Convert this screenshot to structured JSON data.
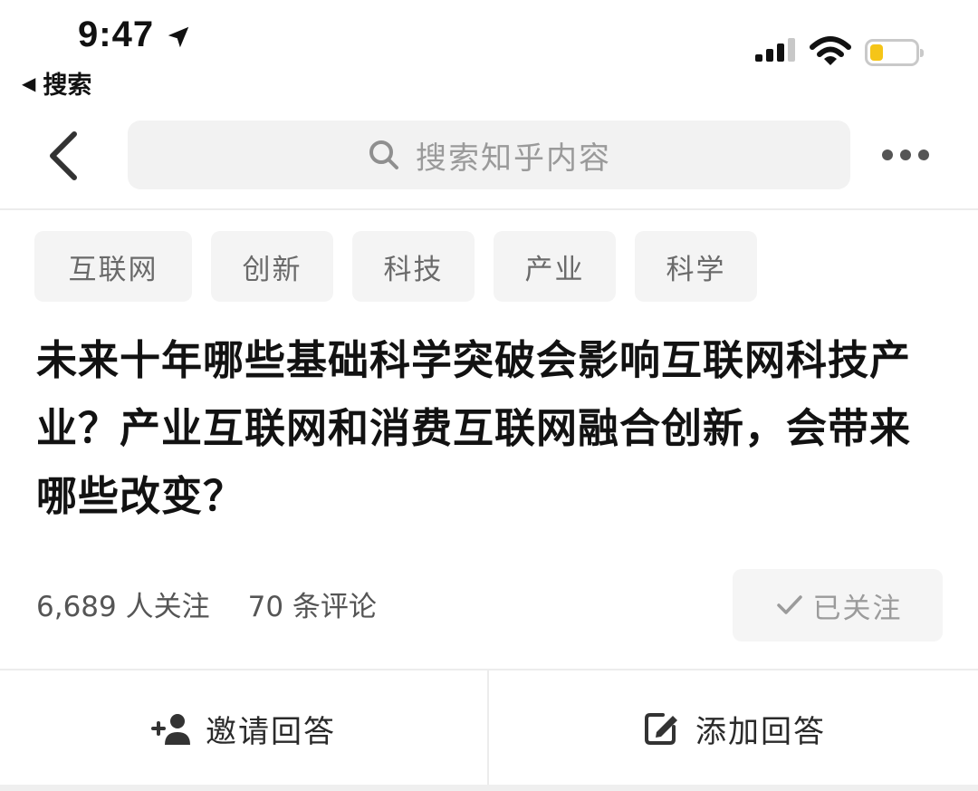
{
  "status_bar": {
    "time": "9:47",
    "back_app_label": "搜索",
    "battery_color": "#f5c518"
  },
  "header": {
    "back_icon": "chevron-left-icon",
    "search_placeholder": "搜索知乎内容",
    "more_icon": "more-dots-icon"
  },
  "tags": [
    "互联网",
    "创新",
    "科技",
    "产业",
    "科学"
  ],
  "question": {
    "title": "未来十年哪些基础科学突破会影响互联网科技产业？产业互联网和消费互联网融合创新，会带来哪些改变？"
  },
  "meta": {
    "followers": "6,689 人关注",
    "comments": "70 条评论",
    "follow_button": "已关注"
  },
  "actions": {
    "invite_label": "邀请回答",
    "invite_icon": "add-person-icon",
    "answer_label": "添加回答",
    "answer_icon": "edit-icon"
  },
  "colors": {
    "tag_bg": "#f4f4f4",
    "search_bg": "#f2f2f2",
    "muted_text": "#9b9b9b"
  }
}
